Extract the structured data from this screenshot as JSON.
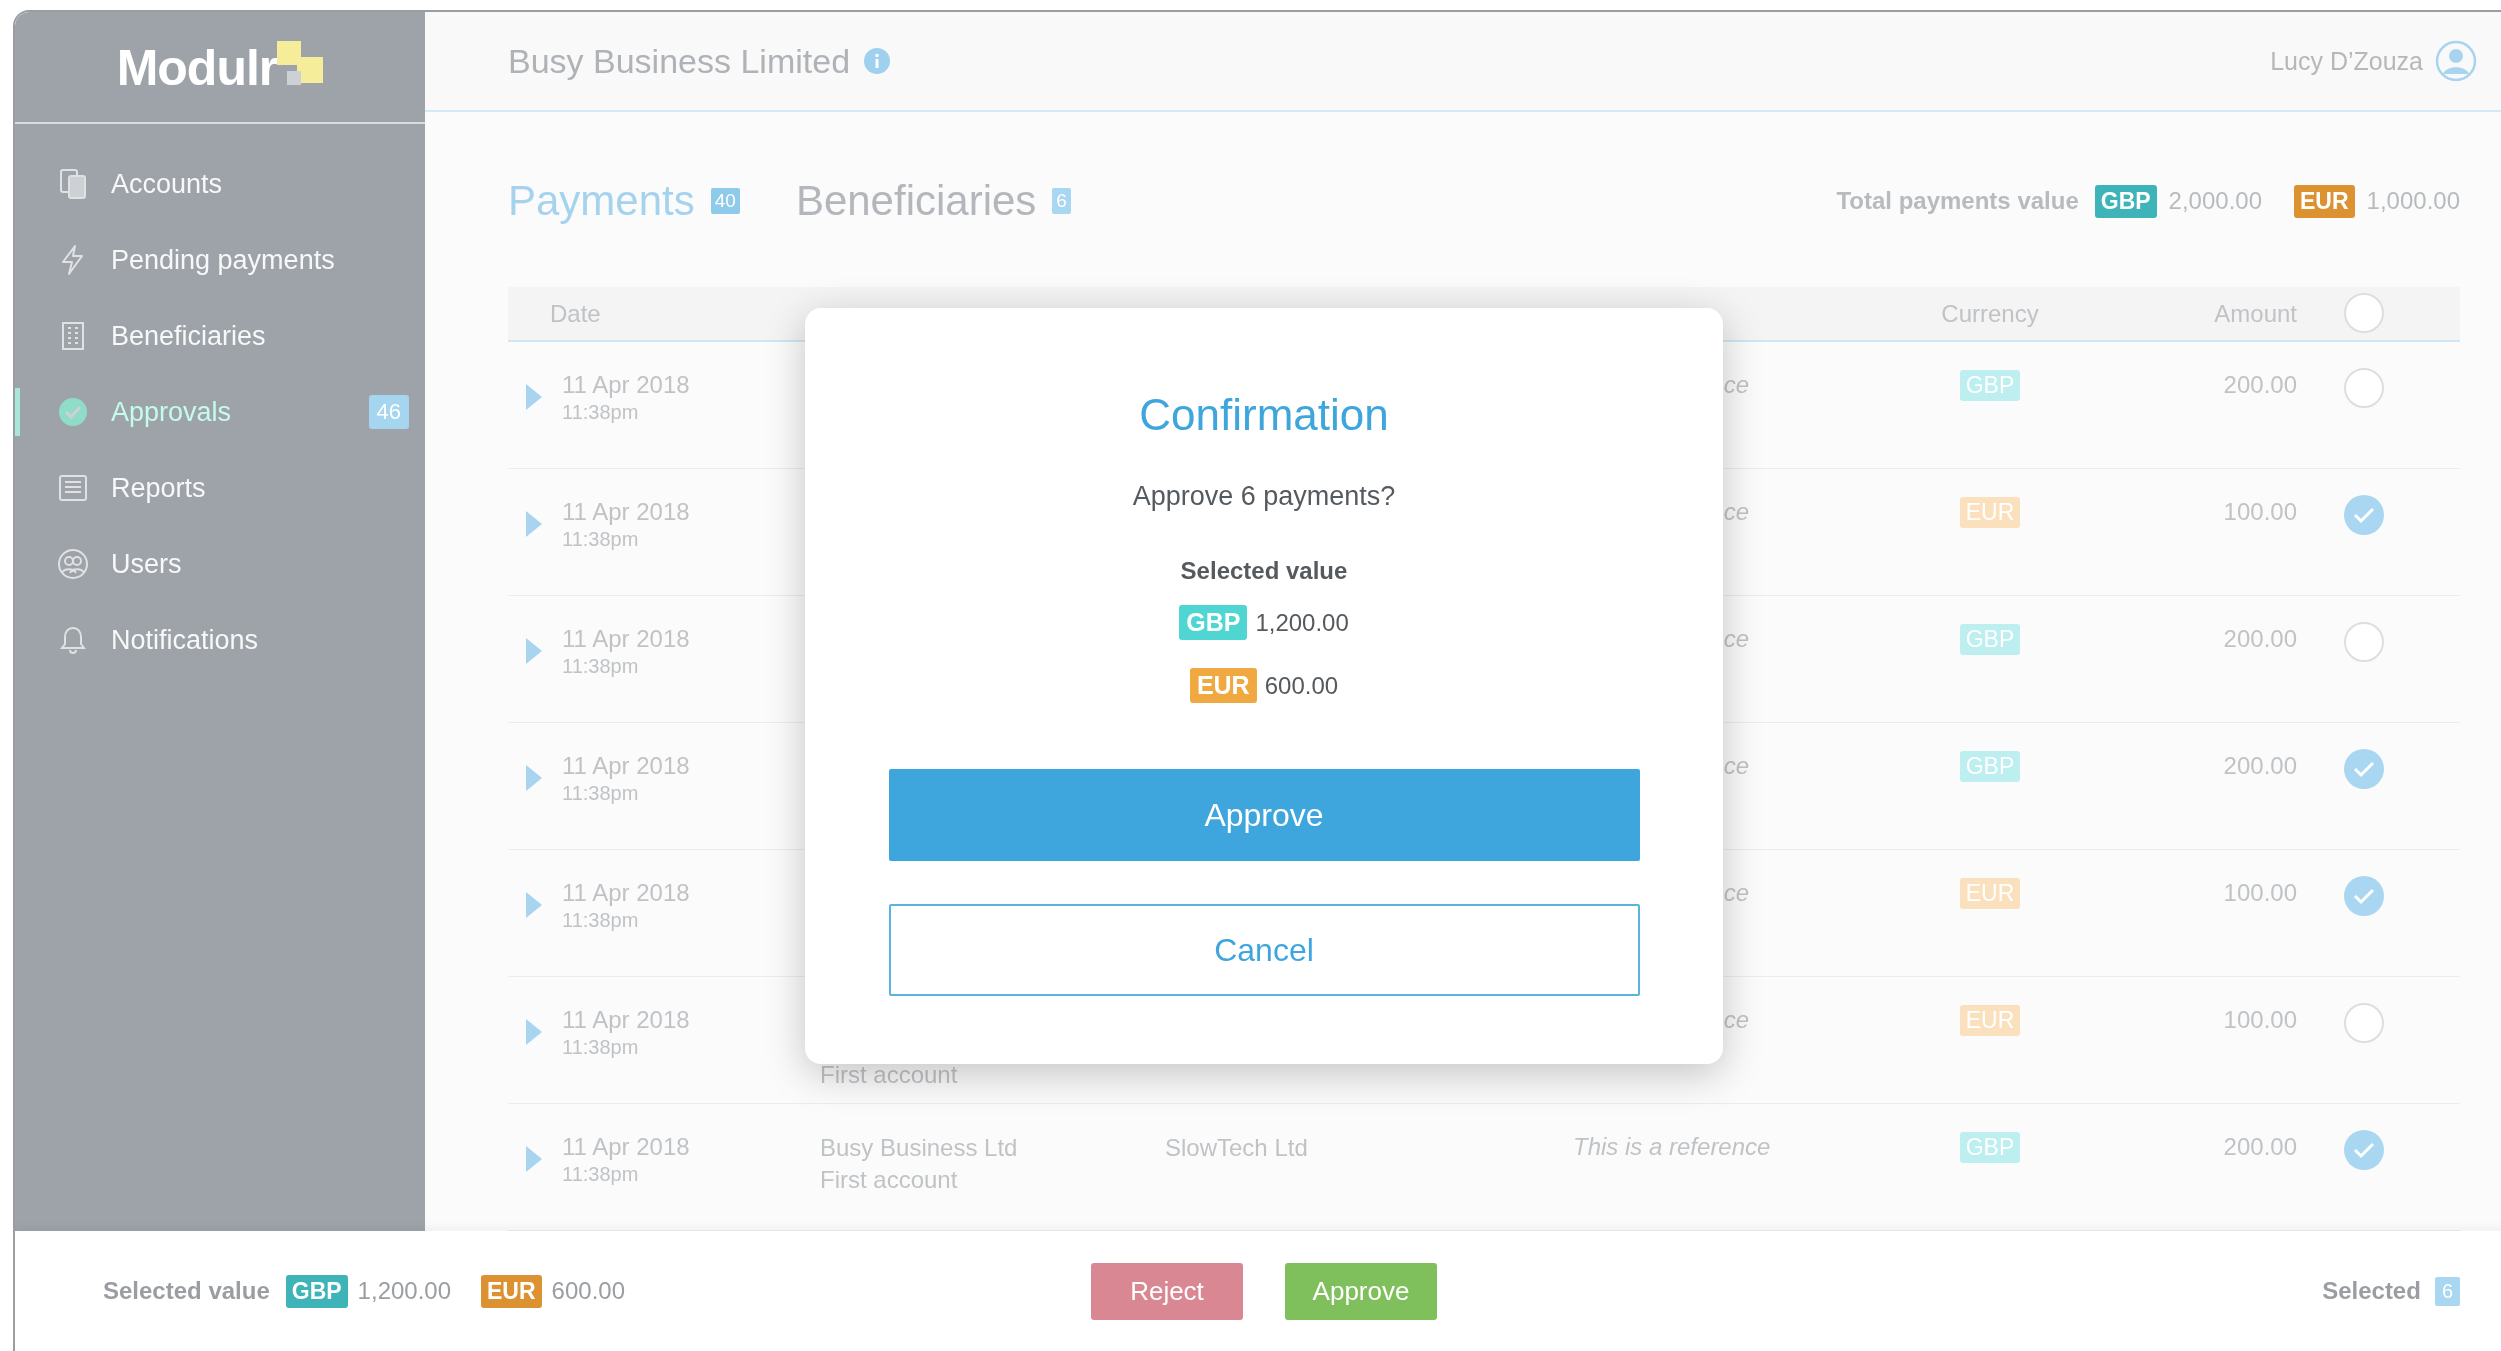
{
  "sidebar": {
    "logo": "Modulr",
    "items": [
      {
        "label": "Accounts",
        "selected": false
      },
      {
        "label": "Pending payments",
        "selected": false
      },
      {
        "label": "Beneficiaries",
        "selected": false
      },
      {
        "label": "Approvals",
        "selected": true,
        "badge": "46"
      },
      {
        "label": "Reports",
        "selected": false
      },
      {
        "label": "Users",
        "selected": false
      },
      {
        "label": "Notifications",
        "selected": false
      }
    ]
  },
  "header": {
    "company": "Busy Business Limited",
    "user": "Lucy D’Zouza"
  },
  "tabs": [
    {
      "label": "Payments",
      "count": "40",
      "selected": true
    },
    {
      "label": "Beneficiaries",
      "count": "6",
      "selected": false
    }
  ],
  "totals": {
    "label": "Total payments value",
    "amounts": [
      {
        "currency": "GBP",
        "value": "2,000.00",
        "color": "#3eb4b9"
      },
      {
        "currency": "EUR",
        "value": "1,000.00",
        "color": "#dc9230"
      }
    ]
  },
  "table": {
    "columns": {
      "date": "Date",
      "currency": "Currency",
      "amount": "Amount"
    },
    "select_all_checked": false,
    "rows": [
      {
        "kind": "under-dialog",
        "date": "11 Apr 2018",
        "time": "11:38pm",
        "reference": "ce",
        "currency": "GBP",
        "color": "#bdeef0",
        "amount": "200.00",
        "selected": false
      },
      {
        "kind": "under-dialog",
        "date": "11 Apr 2018",
        "time": "11:38pm",
        "reference": "ce",
        "currency": "EUR",
        "color": "#fbe0bd",
        "amount": "100.00",
        "selected": true
      },
      {
        "kind": "under-dialog",
        "date": "11 Apr 2018",
        "time": "11:38pm",
        "reference": "ce",
        "currency": "GBP",
        "color": "#bdeef0",
        "amount": "200.00",
        "selected": false
      },
      {
        "kind": "under-dialog",
        "date": "11 Apr 2018",
        "time": "11:38pm",
        "reference": "ce",
        "currency": "GBP",
        "color": "#bdeef0",
        "amount": "200.00",
        "selected": true
      },
      {
        "kind": "under-dialog",
        "date": "11 Apr 2018",
        "time": "11:38pm",
        "reference": "ce",
        "currency": "EUR",
        "color": "#fbe0bd",
        "amount": "100.00",
        "selected": true
      },
      {
        "kind": "under-dialog",
        "date": "11 Apr 2018",
        "time": "11:38pm",
        "account": "First account",
        "reference": "ce",
        "currency": "EUR",
        "color": "#fbe0bd",
        "amount": "100.00",
        "selected": false
      },
      {
        "kind": "plain",
        "date": "11 Apr 2018",
        "time": "11:38pm",
        "from": "Busy Business Ltd",
        "account": "First account",
        "to": "SlowTech Ltd",
        "reference": "This is a reference",
        "currency": "GBP",
        "color": "#bdeef0",
        "amount": "200.00",
        "selected": true
      }
    ]
  },
  "bottom_bar": {
    "label": "Selected value",
    "amounts": [
      {
        "currency": "GBP",
        "value": "1,200.00",
        "color": "#3eb4b9"
      },
      {
        "currency": "EUR",
        "value": "600.00",
        "color": "#dc9230"
      }
    ],
    "buttons": [
      {
        "label": "Reject",
        "kind": "reject"
      },
      {
        "label": "Approve",
        "kind": "approve"
      }
    ],
    "selected_label": "Selected",
    "selected_count": "6"
  },
  "dialog": {
    "title": "Confirmation",
    "question": "Approve 6 payments?",
    "value_label": "Selected value",
    "amounts": [
      {
        "currency": "GBP",
        "value": "1,200.00",
        "color": "#4fd6d2"
      },
      {
        "currency": "EUR",
        "value": "600.00",
        "color": "#f0a840"
      }
    ],
    "confirm": "Approve",
    "cancel": "Cancel"
  }
}
